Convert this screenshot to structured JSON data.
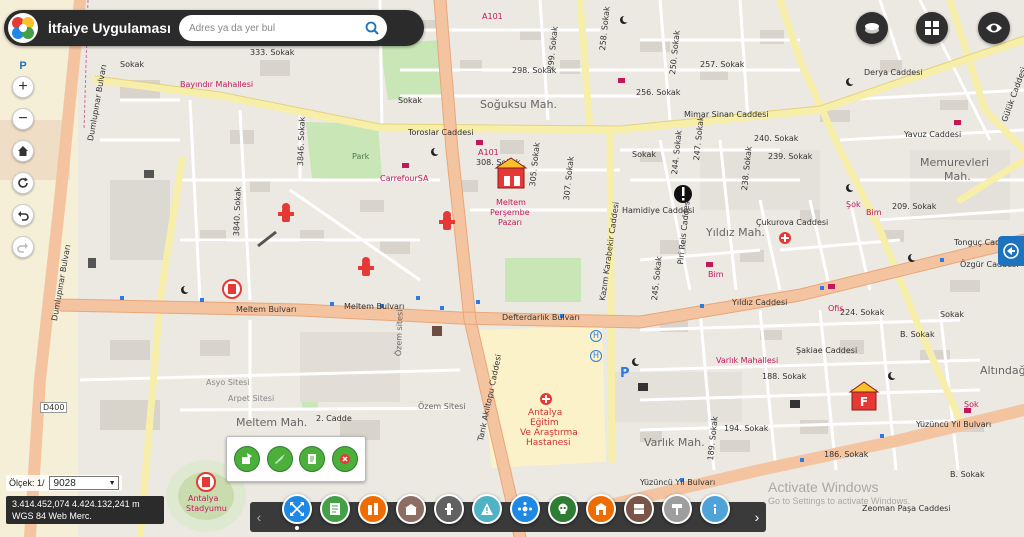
{
  "app": {
    "title": "İtfaiye Uygulaması",
    "search_placeholder": "Adres ya da yer bul"
  },
  "left_tools": {
    "parking_label": "P",
    "zoom_in": "+",
    "zoom_out": "−"
  },
  "scale": {
    "label": "Ölçek: 1/",
    "value": "9028"
  },
  "coordinates": {
    "xy": "3.414.452,074 4.424.132,241 m",
    "system": "WGS 84 Web Merc."
  },
  "watermark": {
    "line1": "Activate Windows",
    "line2": "Go to Settings to activate Windows."
  },
  "map_labels": {
    "area_sogusu": "Soğuksu Mah.",
    "area_memurevleri": "Memurevleri",
    "area_memurevleri2": "Mah.",
    "area_yildiz": "Yıldız Mah.",
    "area_meltem": "Meltem Mah.",
    "area_varlik": "Varlık Mah.",
    "area_altindag": "Altındağ",
    "park": "Park",
    "carrefour": "CarrefourSA",
    "pazar1": "Meltem",
    "pazar2": "Perşembe",
    "pazar3": "Pazarı",
    "hospital1": "Antalya",
    "hospital2": "Eğitim",
    "hospital3": "Ve Araştırma",
    "hospital4": "Hastanesi",
    "stadium1": "Antalya",
    "stadium2": "Stadyumu",
    "bayindir": "Bayındır Mahallesi",
    "toroslar": "Toroslar Caddesi",
    "mimar_sinan": "Mimar Sinan Caddesi",
    "derya": "Derya Caddesi",
    "meltem_bulvari": "Meltem Bulvarı",
    "meltem_bulvari2": "Meltem Bulvarı",
    "defterdarlik": "Defterdarlık Bulvarı",
    "yildiz_cad": "Yıldız Caddesi",
    "tonguc": "Tonguç Caddesi",
    "dumlupinar": "Dumlupınar Bulvarı",
    "dumlupinar2": "Dumlupınar Bulvarı",
    "hamidiye": "Hamidiye Caddesi",
    "cukurova": "Çukurova Caddesi",
    "kazim": "Kazım Karabekir Caddesi",
    "tarik": "Tarık Akıltopu Caddesi",
    "yuzuncu": "Yüzüncü Yıl Bulvarı",
    "yuzuncu2": "Yüzüncü Yıl Bulvarı",
    "piri_reis": "Piri Reis Caddesi",
    "zeoman": "Zeoman Paşa Caddesi",
    "d400": "D400",
    "a101": "A101",
    "a101b": "A101",
    "bim": "Bim",
    "bim2": "Bim",
    "sok": "Şok",
    "sok2": "Şok",
    "ofis": "Ofis",
    "asyo": "Asyo Sitesi",
    "arpet": "Arpet Sitesi",
    "ozem": "Özem Sitesi",
    "ozem2": "Özem sitesi",
    "cadde2": "2. Cadde",
    "s333": "333. Sokak",
    "s298": "298. Sokak",
    "s257": "257. Sokak",
    "s256": "256. Sokak",
    "s308": "308. Sokak",
    "s240": "240. Sokak",
    "s239": "239. Sokak",
    "s209": "209. Sokak",
    "s224": "224. Sokak",
    "s188": "188. Sokak",
    "s194": "194. Sokak",
    "s186": "186. Sokak",
    "s3846": "3846. Sokak",
    "s3840": "3840. Sokak",
    "s305": "305. Sokak",
    "s299": "299. Sokak",
    "s247": "247. Sokak",
    "s238": "238. Sokak",
    "s189": "189. Sokak",
    "s250": "250. Sokak",
    "s245": "245. Sokak",
    "s244": "244. Sokak",
    "s258": "258. Sokak",
    "s307": "307. Sokak",
    "s1sok": "Sokak",
    "s2sok": "Sokak",
    "s3sok": "Sokak",
    "s4sok": "Sokak",
    "guluk": "Gülük Caddesi",
    "sakiae": "Şakiae Caddesi",
    "varlik_mah": "Varlık Mahallesi",
    "yavuz": "Yavuz Caddesi",
    "ozgur": "Özgür Caddesi",
    "b_sok": "B. Sokak",
    "b_sok2": "B. Sokak",
    "h1": "H",
    "h2": "H",
    "p2": "P"
  },
  "colors": {
    "fire_red": "#e53935",
    "accent_blue": "#1e73be",
    "road_major": "#f4c4a1",
    "road_yellow": "#f7eeaa",
    "green": "#4caf3a"
  }
}
